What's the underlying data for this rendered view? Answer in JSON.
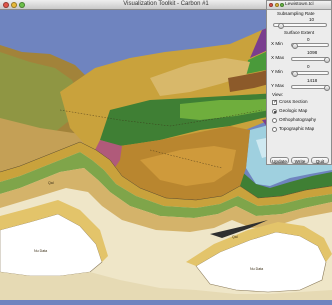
{
  "main_window": {
    "title": "Visualization Toolkit - Carbon #1"
  },
  "map_labels": {
    "label_1": "Nu Data",
    "label_2": "Nu Data",
    "label_3": "Qal",
    "label_4": "Qal"
  },
  "panel": {
    "title": "Lewistown.tcl",
    "subsampling_label": "Subsampling Rate",
    "subsampling_value": "10",
    "surface_extent_label": "Surface Extent",
    "x_min_label": "X Min",
    "x_min_value": "0",
    "x_max_label": "X Max",
    "x_max_value": "1098",
    "y_min_label": "Y Min",
    "y_min_value": "0",
    "y_max_label": "Y Max",
    "y_max_value": "1418",
    "view_label": "View:",
    "cross_section_label": "Cross Section",
    "geologic_map_label": "Geologic Map",
    "orthophotography_label": "Orthophotography",
    "topographic_map_label": "Topographic Map",
    "update_button": "Update",
    "write_button": "Write",
    "quit_button": "Quit"
  },
  "slider_levels": {
    "subsampling": 0.1,
    "x_min": 0.0,
    "x_max": 1.0,
    "y_min": 0.0,
    "y_max": 1.0
  },
  "view_state": {
    "cross_section_checked": true,
    "selected_view": "Geologic Map"
  },
  "colors": {
    "background": "#6f84bf",
    "gold": "#c9a23c",
    "forest_green": "#3f7f34",
    "light_blue": "#9fd0df",
    "purple": "#7a3e8e",
    "cross_section_cream": "#efe6c8"
  },
  "icons": {
    "close": "close-icon",
    "minimize": "minimize-icon",
    "zoom": "zoom-icon"
  }
}
